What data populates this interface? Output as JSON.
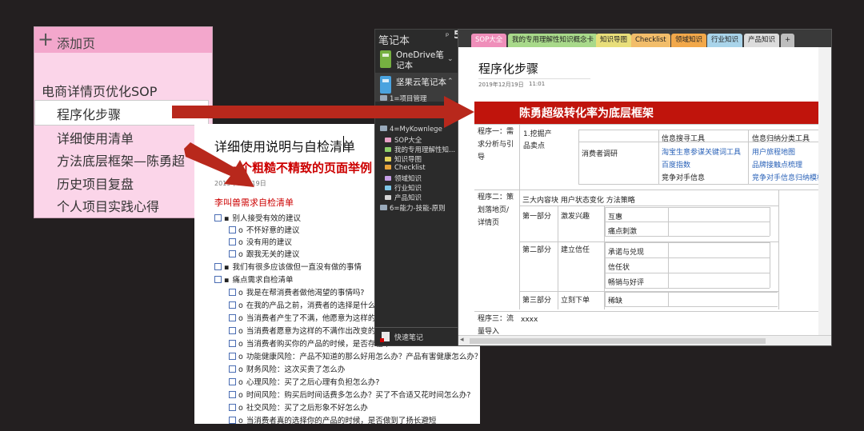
{
  "pagelist": {
    "add_label": "添加页",
    "items": [
      "电商详情页优化SOP",
      "程序化步骤",
      "详细使用清单",
      "方法底层框架—陈勇超",
      "历史项目复盘",
      "个人项目实践心得"
    ]
  },
  "checklist": {
    "title": "详细使用说明与自检清单",
    "subtitle": "一个粗糙不精致的页面举例",
    "date": "2019年12月19日",
    "section": "李叫兽需求自检清单",
    "items": [
      "别人接受有效的建议",
      "不怀好意的建议",
      "没有用的建议",
      "跟我无关的建议",
      "我们有很多应该做但一直没有做的事情",
      "痛点需求自检清单",
      "我是在帮消费者做他渴望的事情吗?",
      "在我的产品之前，消费者的选择是什么？他",
      "当消费者产生了不满，他愿意为这样的不满",
      "当消费者愿意为这样的不满作出改变的时候",
      "当消费者购买你的产品的时候，是否存在下",
      "功能健康风险：产品不知道的那么好用怎么办？产品有害健康怎么办？",
      "财务风险：这次买贵了怎么办",
      "心理风险：买了之后心理有负担怎么办?",
      "时间风险：购买后时间话费多怎么办？买了不合适又花时间怎么办?",
      "社交风险：买了之后形象不好怎么办",
      "当消费者真的选择你的产品的时候，是否做到了扬长避短"
    ]
  },
  "notebook": {
    "header": "笔记本",
    "pin": "ᵖ",
    "count": "5",
    "books": [
      {
        "name": "OneDrive笔记本",
        "color": "#76b041"
      },
      {
        "name": "坚果云笔记本",
        "color": "#4aa3df"
      }
    ],
    "groups": [
      "1=项目管理",
      "4=MyKownlege",
      "6=能力-技能-原则"
    ],
    "sections": [
      {
        "name": "SOP大全",
        "color": "#e8a0c6"
      },
      {
        "name": "我的专用理解性知...",
        "color": "#8fd16a"
      },
      {
        "name": "知识导图",
        "color": "#e4d35a"
      },
      {
        "name": "Checklist",
        "color": "#e8a33a"
      },
      {
        "name": "领域知识",
        "color": "#c6a0e8"
      },
      {
        "name": "行业知识",
        "color": "#7fc8e8"
      },
      {
        "name": "产品知识",
        "color": "#d6d6d6"
      }
    ],
    "quick_notes": "快速笔记"
  },
  "onenote": {
    "tabs": [
      {
        "label": "SOP大全",
        "color": "#ef8fba"
      },
      {
        "label": "我的专用理解性知识概念卡",
        "color": "#a8d98a"
      },
      {
        "label": "知识导图",
        "color": "#e8de7a"
      },
      {
        "label": "Checklist",
        "color": "#f2bd6a"
      },
      {
        "label": "领域知识",
        "color": "#f2a84a"
      },
      {
        "label": "行业知识",
        "color": "#a9d4ea"
      },
      {
        "label": "产品知识",
        "color": "#dcdcdc"
      },
      {
        "label": "+",
        "color": "#bdbdbd"
      }
    ],
    "page_title": "程序化步骤",
    "date": "2019年12月19日",
    "time": "11:01",
    "framework": {
      "banner": "陈勇超级转化率为底层框架",
      "step1": {
        "label": "程序一：需求分析与引导",
        "subhead": "1.挖掘产品卖点",
        "col_search": "信息搜寻工具",
        "col_induce": "信息归纳分类工具",
        "row_research": "消费者调研",
        "search_tools": [
          "淘宝生意参谋关键词工具",
          "百度指数",
          "竞争对手信息"
        ],
        "induce_tools": [
          "用户旅程地图",
          "品牌接触点梳理",
          "竞争对手信息归纳模板"
        ]
      },
      "step2": {
        "label": "程序二：策划落地页/详情页",
        "header": "三大内容块  用户状态变化  方法策略",
        "parts": [
          {
            "part": "第一部分",
            "state": "激发兴趣",
            "methods": [
              "互惠",
              "痛点刺激"
            ]
          },
          {
            "part": "第二部分",
            "state": "建立信任",
            "methods": [
              "承诺与兑现",
              "信任状",
              "畅销与好评"
            ]
          },
          {
            "part": "第三部分",
            "state": "立刻下单",
            "methods": [
              "稀缺"
            ]
          }
        ]
      },
      "step3": {
        "label": "程序三：流量导入",
        "content": "xxxx"
      }
    }
  }
}
